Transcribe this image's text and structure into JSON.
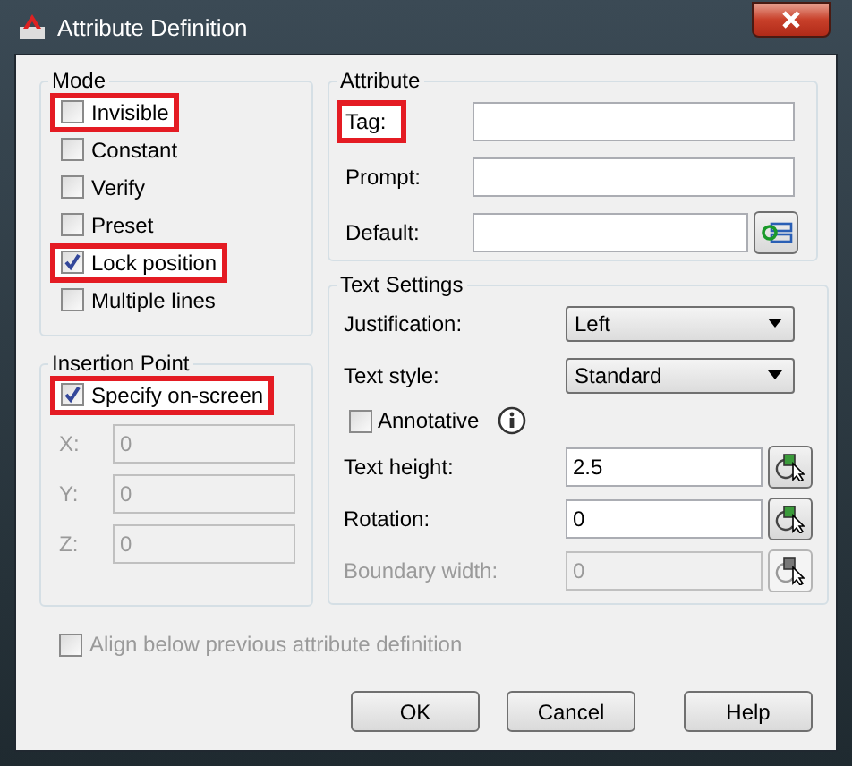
{
  "window": {
    "title": "Attribute Definition"
  },
  "mode": {
    "title": "Mode",
    "options": [
      {
        "label": "Invisible",
        "checked": false,
        "highlighted": true
      },
      {
        "label": "Constant",
        "checked": false,
        "highlighted": false
      },
      {
        "label": "Verify",
        "checked": false,
        "highlighted": false
      },
      {
        "label": "Preset",
        "checked": false,
        "highlighted": false
      },
      {
        "label": "Lock position",
        "checked": true,
        "highlighted": true
      },
      {
        "label": "Multiple lines",
        "checked": false,
        "highlighted": false
      }
    ]
  },
  "insertion_point": {
    "title": "Insertion Point",
    "specify": {
      "label": "Specify on-screen",
      "checked": true,
      "highlighted": true
    },
    "coords": [
      {
        "label": "X:",
        "value": "0",
        "disabled": true
      },
      {
        "label": "Y:",
        "value": "0",
        "disabled": true
      },
      {
        "label": "Z:",
        "value": "0",
        "disabled": true
      }
    ]
  },
  "attribute": {
    "title": "Attribute",
    "fields": [
      {
        "label": "Tag:",
        "highlighted": true,
        "kind": "input"
      },
      {
        "label": "Prompt:",
        "highlighted": false,
        "kind": "input"
      },
      {
        "label": "Default:",
        "highlighted": false,
        "kind": "field-input"
      }
    ]
  },
  "text_settings": {
    "title": "Text Settings",
    "rows": [
      {
        "kind": "select",
        "label": "Justification:",
        "value": "Left",
        "disabled": false
      },
      {
        "kind": "select",
        "label": "Text style:",
        "value": "Standard",
        "disabled": false
      },
      {
        "kind": "checkbox",
        "label": "Annotative",
        "checked": false,
        "disabled": false
      },
      {
        "kind": "pick",
        "label": "Text height:",
        "value": "2.5",
        "disabled": false
      },
      {
        "kind": "pick",
        "label": "Rotation:",
        "value": "0",
        "disabled": false
      },
      {
        "kind": "pick",
        "label": "Boundary width:",
        "value": "0",
        "disabled": true
      }
    ]
  },
  "align": {
    "label": "Align below previous attribute definition",
    "checked": false,
    "disabled": true
  },
  "buttons": [
    "OK",
    "Cancel",
    "Help"
  ]
}
